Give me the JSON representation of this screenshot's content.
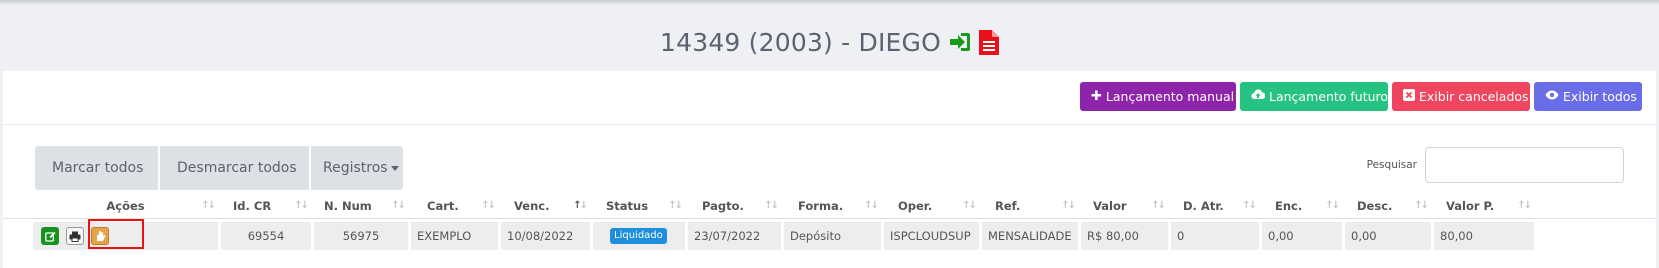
{
  "header": {
    "title": "14349 (2003) - DIEGO",
    "icons": [
      "sign-in-icon",
      "pdf-file-icon"
    ],
    "colors": {
      "sign_in": "#1a9a1a",
      "pdf": "#e8101a"
    }
  },
  "toolbar": {
    "buttons": [
      {
        "icon": "plus-icon",
        "label": "Lançamento manual",
        "color": "#8e24aa"
      },
      {
        "icon": "cloud-upload-icon",
        "label": "Lançamento futuro",
        "color": "#26c281"
      },
      {
        "icon": "x-box-icon",
        "label": "Exibir cancelados",
        "color": "#f0455e"
      },
      {
        "icon": "eye-icon",
        "label": "Exibir todos",
        "color": "#6a6de8"
      }
    ]
  },
  "selection": {
    "mark_all": "Marcar todos",
    "unmark_all": "Desmarcar todos",
    "records": "Registros"
  },
  "search": {
    "label": "Pesquisar",
    "value": "",
    "placeholder": ""
  },
  "table": {
    "columns": [
      "Ações",
      "Id. CR",
      "N. Num",
      "Cart.",
      "Venc.",
      "Status",
      "Pagto.",
      "Forma.",
      "Oper.",
      "Ref.",
      "Valor",
      "D. Atr.",
      "Enc.",
      "Desc.",
      "Valor P."
    ],
    "sorted_column": "Venc.",
    "rows": [
      {
        "id_cr": "69554",
        "n_num": "56975",
        "cart": "EXEMPLO",
        "venc": "10/08/2022",
        "status": "Liquidado",
        "pagto": "23/07/2022",
        "forma": "Depósito",
        "oper": "ISPCLOUDSUP",
        "ref": "MENSALIDADE",
        "valor": "R$ 80,00",
        "d_atr": "0",
        "enc": "0,00",
        "desc": "0,00",
        "valor_p": "80,00",
        "actions": [
          "edit-icon",
          "print-icon",
          "hand-icon"
        ]
      }
    ]
  }
}
